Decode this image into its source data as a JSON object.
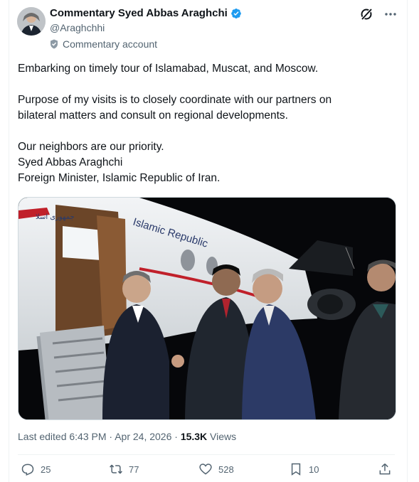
{
  "tweet": {
    "author": {
      "display_name": "Commentary Syed Abbas Araghchi",
      "handle": "@Araghchhi",
      "label": "Commentary account"
    },
    "text_lines": [
      "Embarking on timely tour of Islamabad, Muscat, and Moscow.",
      "Purpose of my visits is to closely coordinate with our partners on",
      "bilateral matters and consult on regional developments.",
      "Our neighbors are our priority.",
      "Syed Abbas Araghchi",
      "Foreign Minister, Islamic Republic of Iran."
    ],
    "media": {
      "aircraft_text": "Islamic Republic",
      "aircraft_script": "جمهوری اسلا"
    },
    "meta": {
      "edited_time": "Last edited 6:43 PM · Apr 24, 2026 · ",
      "views_count": "15.3K",
      "views_label": " Views"
    },
    "actions": {
      "replies": "25",
      "reposts": "77",
      "likes": "528",
      "bookmarks": "10"
    }
  }
}
